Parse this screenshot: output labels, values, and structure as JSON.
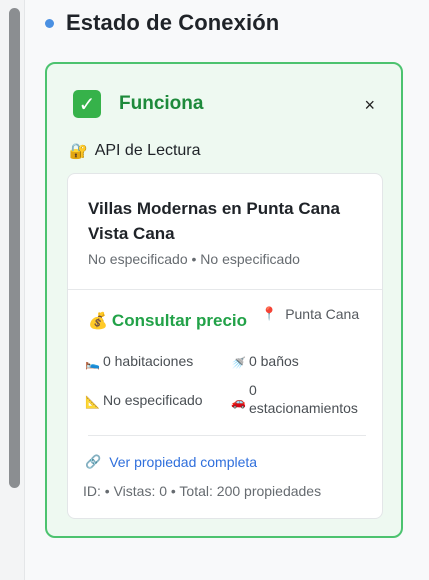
{
  "header": {
    "title": "Estado de Conexión"
  },
  "status": {
    "text": "Funciona",
    "close": "×"
  },
  "api": {
    "label": "API de Lectura"
  },
  "property": {
    "title": "Villas Modernas en Punta Cana Vista Cana",
    "subtitle": "No especificado • No especificado",
    "price_label": "Consultar precio",
    "location": "Punta Cana",
    "bedrooms": "0 habitaciones",
    "bathrooms": "0 baños",
    "area": "No especificado",
    "parking_count": "0",
    "parking_label": "estacionamientos",
    "view_link": "Ver propiedad completa",
    "meta": "ID: • Vistas: 0 • Total: 200 propiedades"
  },
  "icons": {
    "status": "check-icon",
    "api": "lock-icon",
    "price": "money-bag-icon",
    "location": "pin-icon",
    "bed": "bed-icon",
    "bath": "bath-icon",
    "area": "ruler-icon",
    "parking": "car-icon",
    "link": "link-icon"
  },
  "colors": {
    "accent": "#4a90e2",
    "success": "#1d8a3b",
    "success_border": "#4cc36f",
    "price": "#22a248",
    "link": "#2f6fdc"
  }
}
